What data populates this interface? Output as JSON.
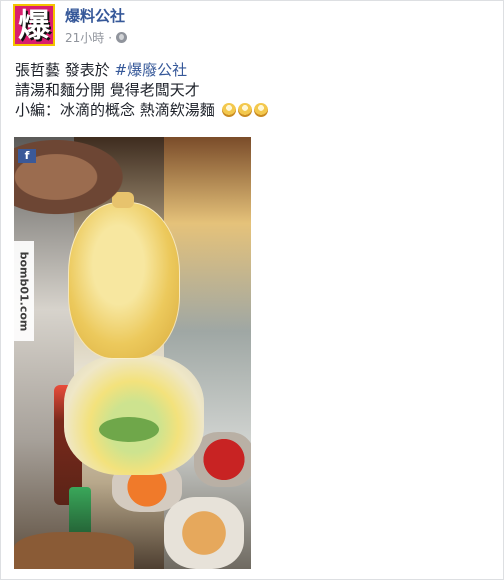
{
  "post": {
    "page_name": "爆料公社",
    "avatar_text": "爆",
    "timestamp": "21小時",
    "separator": "·",
    "privacy_icon": "globe-icon",
    "lines": {
      "line1_prefix": "張哲藝 發表於 ",
      "line1_hashtag": "#爆廢公社",
      "line2": "請湯和麵分開 覺得老闆天才",
      "line3": "小編：冰滴的概念 熱滴欸湯麵"
    },
    "emoji_count": 3,
    "emoji_icon": "noodle-bowl-icon",
    "photo": {
      "watermark": "bomb01.com",
      "corner_mark": "f"
    }
  },
  "colors": {
    "link": "#365899",
    "meta": "#90949c",
    "text": "#1d2129",
    "avatar_bg": "#d91f6e"
  }
}
